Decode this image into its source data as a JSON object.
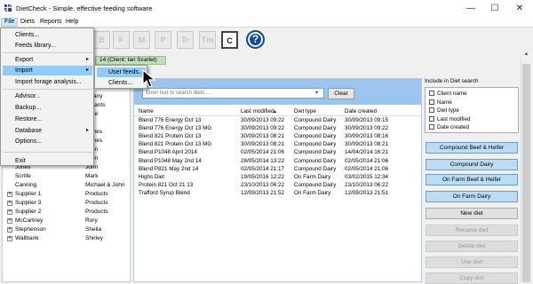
{
  "window": {
    "title": "DietCheck - Simple, effective feeding software",
    "minimize": "—",
    "maximize": "☐",
    "close": "✕"
  },
  "menubar": [
    "File",
    "Diets",
    "Reports",
    "Help"
  ],
  "toolbar": {
    "buttons": [
      "B",
      "F",
      "M",
      "P",
      "Tr",
      "Tm",
      "C"
    ],
    "help": "?"
  },
  "client_tab": "14 (Client: Ian Scarlet)",
  "tree": {
    "rows": [
      {
        "exp": "",
        "c1": "",
        "c2": "mpany"
      },
      {
        "exp": "",
        "c1": "",
        "c2": "sultants"
      },
      {
        "exp": "",
        "c1": "",
        "c2": "mple"
      },
      {
        "exp": "",
        "c1": "Green",
        "c2": "Ian"
      },
      {
        "exp": "",
        "c1": "Templeton",
        "c2": "James"
      },
      {
        "exp": "+",
        "c1": "Jones",
        "c2": "James"
      },
      {
        "exp": "",
        "c1": "Brown",
        "c2": "John"
      },
      {
        "exp": "",
        "c1": "Smith",
        "c2": "John"
      },
      {
        "exp": "",
        "c1": "Jones",
        "c2": "John"
      },
      {
        "exp": "",
        "c1": "Scrille",
        "c2": "Mark"
      },
      {
        "exp": "",
        "c1": "Canning",
        "c2": "Michael & John"
      },
      {
        "exp": "+",
        "c1": "Supplier 1",
        "c2": "Products"
      },
      {
        "exp": "+",
        "c1": "Supplier 3",
        "c2": "Products"
      },
      {
        "exp": "+",
        "c1": "Supplier 2",
        "c2": "Products"
      },
      {
        "exp": "+",
        "c1": "McCartney",
        "c2": "Rory"
      },
      {
        "exp": "+",
        "c1": "Stephenson",
        "c2": "Sheila"
      },
      {
        "exp": "+",
        "c1": "Wallbank",
        "c2": "Shirley"
      }
    ]
  },
  "search": {
    "placeholder": "Enter text to search diets ...",
    "caret": "▾",
    "clear": "Clear"
  },
  "table": {
    "headers": {
      "name": "Name",
      "modified": "Last modified",
      "type": "Diet type",
      "created": "Date created"
    },
    "sort_indicator": "▲",
    "rows": [
      {
        "name": "Blend 776 Energy Oct 13",
        "modified": "30/09/2013 09:22",
        "type": "Compound Dairy",
        "created": "30/09/2013 09:15"
      },
      {
        "name": "Blend 776 Energy Oct 13 MG",
        "modified": "30/09/2013 09:22",
        "type": "Compound Dairy",
        "created": "30/09/2013 09:22"
      },
      {
        "name": "Blend 821 Protein Oct 13",
        "modified": "30/09/2013 08:21",
        "type": "Compound Dairy",
        "created": "30/09/2013 08:16"
      },
      {
        "name": "Blend 821 Protein Oct 13 MG",
        "modified": "30/09/2013 08:21",
        "type": "Compound Dairy",
        "created": "30/09/2013 08:21"
      },
      {
        "name": "Blend P1048 April 2014",
        "modified": "02/05/2014 21:06",
        "type": "Compound Dairy",
        "created": "14/04/2014 16:21"
      },
      {
        "name": "Blend P1048 May 2nd 14",
        "modified": "28/05/2014 13:22",
        "type": "Compound Dairy",
        "created": "02/05/2014 21:06"
      },
      {
        "name": "Blend P821 May 2nd 14",
        "modified": "02/05/2014 21:17",
        "type": "Compound Dairy",
        "created": "02/05/2014 21:06"
      },
      {
        "name": "Highs Diet",
        "modified": "19/05/2016 12:22",
        "type": "On Farm Dairy",
        "created": "03/02/2015 12:34"
      },
      {
        "name": "Protein 821 Oct 21 13",
        "modified": "23/10/2013 06:22",
        "type": "Compound Dairy",
        "created": "23/10/2013 06:22"
      },
      {
        "name": "Trafford Syrup Blend",
        "modified": "12/09/2013 21:52",
        "type": "On Farm Dairy",
        "created": "12/09/2013 21:51"
      }
    ]
  },
  "right_panel": {
    "label": "Include in Diet search",
    "checkboxes": [
      "Client name",
      "Name",
      "Diet type",
      "Last modified",
      "Date created"
    ],
    "buttons": [
      "Compound Beef & Heifer",
      "Compound Dairy",
      "On Farm Beef & Heifer",
      "On Farm Dairy",
      "New diet",
      "Rename diet",
      "Delete diet",
      "Use diet",
      "Copy diet"
    ]
  },
  "file_menu": {
    "items": [
      {
        "label": "Clients...",
        "arrow": ""
      },
      {
        "label": "Feeds library...",
        "arrow": ""
      },
      {
        "label": "Export",
        "arrow": "▸"
      },
      {
        "label": "Import",
        "arrow": "▸"
      },
      {
        "label": "Import forage analysis...",
        "arrow": ""
      },
      {
        "label": "Advisor...",
        "arrow": ""
      },
      {
        "label": "Backup...",
        "arrow": ""
      },
      {
        "label": "Restore...",
        "arrow": ""
      },
      {
        "label": "Database",
        "arrow": "▸"
      },
      {
        "label": "Options...",
        "arrow": ""
      },
      {
        "label": "Exit",
        "arrow": ""
      }
    ]
  },
  "import_submenu": [
    "User feeds...",
    "Clients..."
  ],
  "scrollbar": {
    "up": "▲"
  },
  "colors": {
    "accent_blue": "#9ac5ee",
    "menu_highlight": "#91c9f7",
    "client_tab": "#c2deb9",
    "help_icon": "#0a4aa0"
  }
}
